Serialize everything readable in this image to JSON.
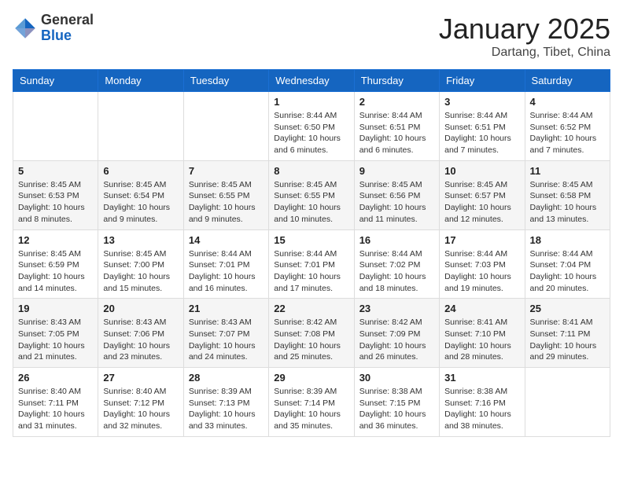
{
  "header": {
    "logo_general": "General",
    "logo_blue": "Blue",
    "month_title": "January 2025",
    "location": "Dartang, Tibet, China"
  },
  "days_of_week": [
    "Sunday",
    "Monday",
    "Tuesday",
    "Wednesday",
    "Thursday",
    "Friday",
    "Saturday"
  ],
  "weeks": [
    [
      {
        "day": "",
        "info": ""
      },
      {
        "day": "",
        "info": ""
      },
      {
        "day": "",
        "info": ""
      },
      {
        "day": "1",
        "info": "Sunrise: 8:44 AM\nSunset: 6:50 PM\nDaylight: 10 hours and 6 minutes."
      },
      {
        "day": "2",
        "info": "Sunrise: 8:44 AM\nSunset: 6:51 PM\nDaylight: 10 hours and 6 minutes."
      },
      {
        "day": "3",
        "info": "Sunrise: 8:44 AM\nSunset: 6:51 PM\nDaylight: 10 hours and 7 minutes."
      },
      {
        "day": "4",
        "info": "Sunrise: 8:44 AM\nSunset: 6:52 PM\nDaylight: 10 hours and 7 minutes."
      }
    ],
    [
      {
        "day": "5",
        "info": "Sunrise: 8:45 AM\nSunset: 6:53 PM\nDaylight: 10 hours and 8 minutes."
      },
      {
        "day": "6",
        "info": "Sunrise: 8:45 AM\nSunset: 6:54 PM\nDaylight: 10 hours and 9 minutes."
      },
      {
        "day": "7",
        "info": "Sunrise: 8:45 AM\nSunset: 6:55 PM\nDaylight: 10 hours and 9 minutes."
      },
      {
        "day": "8",
        "info": "Sunrise: 8:45 AM\nSunset: 6:55 PM\nDaylight: 10 hours and 10 minutes."
      },
      {
        "day": "9",
        "info": "Sunrise: 8:45 AM\nSunset: 6:56 PM\nDaylight: 10 hours and 11 minutes."
      },
      {
        "day": "10",
        "info": "Sunrise: 8:45 AM\nSunset: 6:57 PM\nDaylight: 10 hours and 12 minutes."
      },
      {
        "day": "11",
        "info": "Sunrise: 8:45 AM\nSunset: 6:58 PM\nDaylight: 10 hours and 13 minutes."
      }
    ],
    [
      {
        "day": "12",
        "info": "Sunrise: 8:45 AM\nSunset: 6:59 PM\nDaylight: 10 hours and 14 minutes."
      },
      {
        "day": "13",
        "info": "Sunrise: 8:45 AM\nSunset: 7:00 PM\nDaylight: 10 hours and 15 minutes."
      },
      {
        "day": "14",
        "info": "Sunrise: 8:44 AM\nSunset: 7:01 PM\nDaylight: 10 hours and 16 minutes."
      },
      {
        "day": "15",
        "info": "Sunrise: 8:44 AM\nSunset: 7:01 PM\nDaylight: 10 hours and 17 minutes."
      },
      {
        "day": "16",
        "info": "Sunrise: 8:44 AM\nSunset: 7:02 PM\nDaylight: 10 hours and 18 minutes."
      },
      {
        "day": "17",
        "info": "Sunrise: 8:44 AM\nSunset: 7:03 PM\nDaylight: 10 hours and 19 minutes."
      },
      {
        "day": "18",
        "info": "Sunrise: 8:44 AM\nSunset: 7:04 PM\nDaylight: 10 hours and 20 minutes."
      }
    ],
    [
      {
        "day": "19",
        "info": "Sunrise: 8:43 AM\nSunset: 7:05 PM\nDaylight: 10 hours and 21 minutes."
      },
      {
        "day": "20",
        "info": "Sunrise: 8:43 AM\nSunset: 7:06 PM\nDaylight: 10 hours and 23 minutes."
      },
      {
        "day": "21",
        "info": "Sunrise: 8:43 AM\nSunset: 7:07 PM\nDaylight: 10 hours and 24 minutes."
      },
      {
        "day": "22",
        "info": "Sunrise: 8:42 AM\nSunset: 7:08 PM\nDaylight: 10 hours and 25 minutes."
      },
      {
        "day": "23",
        "info": "Sunrise: 8:42 AM\nSunset: 7:09 PM\nDaylight: 10 hours and 26 minutes."
      },
      {
        "day": "24",
        "info": "Sunrise: 8:41 AM\nSunset: 7:10 PM\nDaylight: 10 hours and 28 minutes."
      },
      {
        "day": "25",
        "info": "Sunrise: 8:41 AM\nSunset: 7:11 PM\nDaylight: 10 hours and 29 minutes."
      }
    ],
    [
      {
        "day": "26",
        "info": "Sunrise: 8:40 AM\nSunset: 7:11 PM\nDaylight: 10 hours and 31 minutes."
      },
      {
        "day": "27",
        "info": "Sunrise: 8:40 AM\nSunset: 7:12 PM\nDaylight: 10 hours and 32 minutes."
      },
      {
        "day": "28",
        "info": "Sunrise: 8:39 AM\nSunset: 7:13 PM\nDaylight: 10 hours and 33 minutes."
      },
      {
        "day": "29",
        "info": "Sunrise: 8:39 AM\nSunset: 7:14 PM\nDaylight: 10 hours and 35 minutes."
      },
      {
        "day": "30",
        "info": "Sunrise: 8:38 AM\nSunset: 7:15 PM\nDaylight: 10 hours and 36 minutes."
      },
      {
        "day": "31",
        "info": "Sunrise: 8:38 AM\nSunset: 7:16 PM\nDaylight: 10 hours and 38 minutes."
      },
      {
        "day": "",
        "info": ""
      }
    ]
  ]
}
